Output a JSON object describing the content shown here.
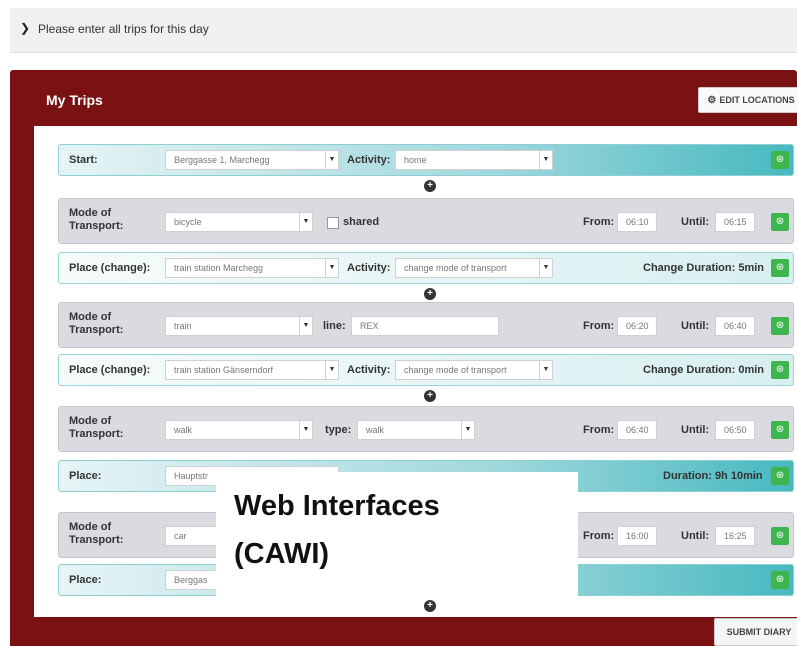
{
  "header": {
    "icon": "chevron-down-icon",
    "title": "Please enter all trips for this day"
  },
  "panel": {
    "title": "My Trips",
    "edit_locations": "EDIT LOCATIONS",
    "submit": "SUBMIT DIARY",
    "accent_color": "#7a1214",
    "ok_color": "#3fb550"
  },
  "labels": {
    "start": "Start:",
    "activity": "Activity:",
    "mode": "Mode of Transport:",
    "place_change": "Place (change):",
    "place": "Place:",
    "from": "From:",
    "until": "Until:",
    "shared": "shared",
    "line": "line:",
    "type": "type:"
  },
  "start": {
    "location": "Berggasse 1, Marchegg",
    "activity": "home"
  },
  "trip1": {
    "mode": "bicycle",
    "from": "06:10",
    "until": "06:15"
  },
  "change1": {
    "place": "train station Marchegg",
    "activity": "change mode of transport",
    "duration": "Change Duration: 5min"
  },
  "trip2": {
    "mode": "train",
    "line": "REX",
    "from": "06:20",
    "until": "06:40"
  },
  "change2": {
    "place": "train station Gänserndorf",
    "activity": "change mode of transport",
    "duration": "Change Duration: 0min"
  },
  "trip3": {
    "mode": "walk",
    "type": "walk",
    "from": "06:40",
    "until": "06:50"
  },
  "place1": {
    "place": "Hauptstr",
    "duration": "Duration: 9h 10min"
  },
  "trip4": {
    "mode": "car",
    "from": "16:00",
    "until": "16:25"
  },
  "place2": {
    "place": "Berggas"
  },
  "overlay": {
    "line1": "Web Interfaces",
    "line2": "(CAWI)"
  }
}
